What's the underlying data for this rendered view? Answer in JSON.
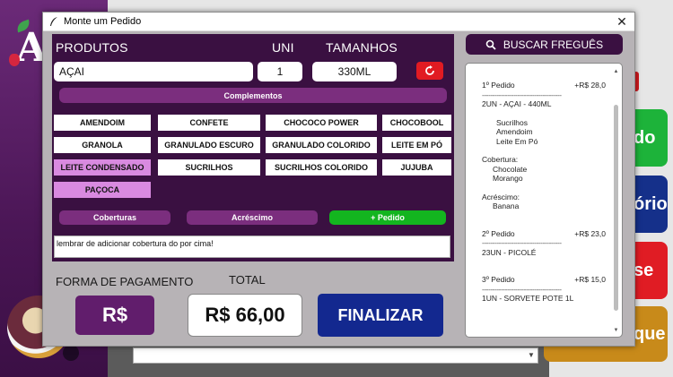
{
  "dialog": {
    "title": "Monte um Pedido",
    "close_icon": "close-icon"
  },
  "products": {
    "header_produtos": "PRODUTOS",
    "header_uni": "UNI",
    "header_tamanhos": "TAMANHOS",
    "produto_value": "AÇAI",
    "uni_value": "1",
    "tamanho_value": "330ML",
    "refresh_icon": "refresh-icon",
    "complementos_label": "Complementos",
    "complementos": [
      {
        "label": "AMENDOIM",
        "selected": false
      },
      {
        "label": "CONFETE",
        "selected": false
      },
      {
        "label": "CHOCOCO POWER",
        "selected": false
      },
      {
        "label": "CHOCOBOOL",
        "selected": false
      },
      {
        "label": "GRANOLA",
        "selected": false
      },
      {
        "label": "GRANULADO ESCURO",
        "selected": false
      },
      {
        "label": "GRANULADO COLORIDO",
        "selected": false
      },
      {
        "label": "LEITE EM PÓ",
        "selected": false
      },
      {
        "label": "LEITE CONDENSADO",
        "selected": true
      },
      {
        "label": "SUCRILHOS",
        "selected": false
      },
      {
        "label": "SUCRILHOS COLORIDO",
        "selected": false
      },
      {
        "label": "JUJUBA",
        "selected": false
      },
      {
        "label": "PAÇOCA",
        "selected": true
      }
    ],
    "coberturas_label": "Coberturas",
    "acrescimo_label": "Acréscimo",
    "add_pedido_label": "+ Pedido",
    "note_value": "lembrar de adicionar cobertura do por cima!",
    "selected_color": "#d98ae0"
  },
  "payment": {
    "forma_label": "FORMA DE PAGAMENTO",
    "total_label": "TOTAL",
    "currency_button": "R$",
    "total_value": "R$ 66,00",
    "finalizar_label": "FINALIZAR"
  },
  "customer": {
    "search_label": "BUSCAR FREGUÊS",
    "search_icon": "search-icon"
  },
  "receipt": {
    "orders": [
      {
        "title": "1º Pedido",
        "price": "+R$ 28,0",
        "separator": "--------------------------------------",
        "item": "2UN - AÇAI - 440ML",
        "complementos": [
          "Sucrilhos",
          "Amendoim",
          "Leite Em Pó"
        ],
        "cobertura_label": "Cobertura:",
        "coberturas": [
          "Chocolate",
          "Morango"
        ],
        "acrescimo_label": "Acréscimo:",
        "acrescimos": [
          "Banana"
        ]
      },
      {
        "title": "2º Pedido",
        "price": "+R$ 23,0",
        "separator": "--------------------------------------",
        "item": "23UN - PICOLÉ"
      },
      {
        "title": "3º Pedido",
        "price": "+R$ 15,0",
        "separator": "--------------------------------------",
        "item": "1UN - SORVETE POTE 1L"
      }
    ]
  },
  "background": {
    "logo_text": "A",
    "tile_labels": [
      "do",
      "ório",
      "se",
      "que"
    ]
  },
  "colors": {
    "accent_purple": "#3a1041",
    "button_purple": "#611d6c",
    "finalizar_blue": "#13288f",
    "add_green": "#13b51f",
    "refresh_red": "#e11b22"
  }
}
